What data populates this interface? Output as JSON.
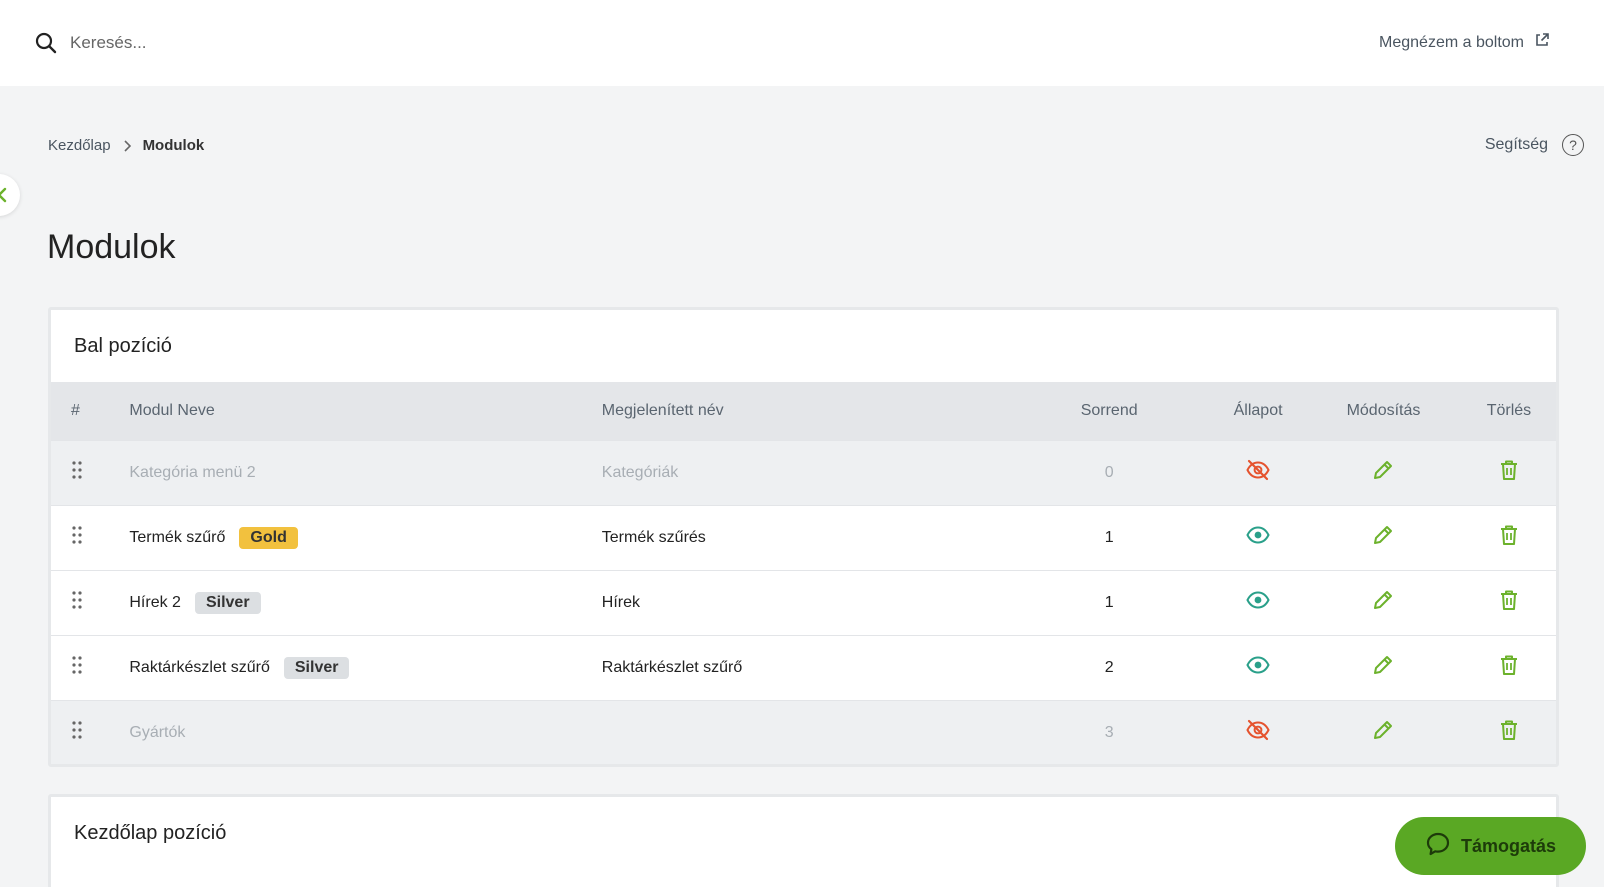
{
  "search": {
    "placeholder": "Keresés...",
    "value": ""
  },
  "header": {
    "view_shop_label": "Megnézem a boltom"
  },
  "breadcrumb": {
    "home": "Kezdőlap",
    "current": "Modulok"
  },
  "help": {
    "label": "Segítség",
    "icon_glyph": "?"
  },
  "page": {
    "title": "Modulok"
  },
  "sections": [
    {
      "title": "Bal pozíció",
      "columns": [
        "#",
        "Modul Neve",
        "Megjelenített név",
        "Sorrend",
        "Állapot",
        "Módosítás",
        "Törlés"
      ],
      "rows": [
        {
          "name": "Kategória menü 2",
          "badge": "",
          "badge_type": "",
          "display_name": "Kategóriák",
          "order": "0",
          "visible": false
        },
        {
          "name": "Termék szűrő",
          "badge": "Gold",
          "badge_type": "gold",
          "display_name": "Termék szűrés",
          "order": "1",
          "visible": true
        },
        {
          "name": "Hírek 2",
          "badge": "Silver",
          "badge_type": "silver",
          "display_name": "Hírek",
          "order": "1",
          "visible": true
        },
        {
          "name": "Raktárkészlet szűrő",
          "badge": "Silver",
          "badge_type": "silver",
          "display_name": "Raktárkészlet szűrő",
          "order": "2",
          "visible": true
        },
        {
          "name": "Gyártók",
          "badge": "",
          "badge_type": "",
          "display_name": "",
          "order": "3",
          "visible": false
        }
      ]
    },
    {
      "title": "Kezdőlap pozíció"
    }
  ],
  "support": {
    "label": "Támogatás"
  },
  "colors": {
    "visible_icon": "#2aa08a",
    "hidden_icon": "#e5532e",
    "action_icon": "#6cb22c",
    "support_bg": "#5aa824",
    "gold_badge": "#f2c13e",
    "silver_badge": "#dcdfe2"
  },
  "icons": {
    "drag": "drag-handle-icon",
    "visible": "eye-icon",
    "hidden": "eye-off-icon",
    "edit": "pencil-icon",
    "delete": "trash-icon"
  }
}
